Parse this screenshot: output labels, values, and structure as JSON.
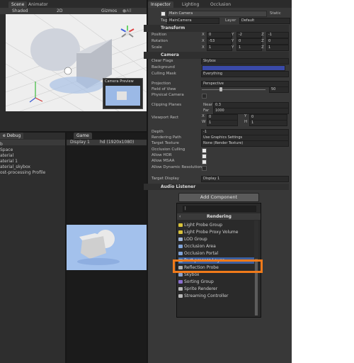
{
  "scene": {
    "tabs": [
      "Scene",
      "Animator"
    ],
    "shading": "Shaded",
    "mode_2d": "2D",
    "gizmos": "Gizmos",
    "search": "●All",
    "camera_preview_title": "Camera Preview"
  },
  "left_panel": {
    "tab": "e Debug",
    "items": [
      "b",
      "Space",
      "aterial",
      "aterial 1",
      "aterial_skybox",
      "ost-processing Profile"
    ]
  },
  "game": {
    "tab": "Game",
    "display": "Display 1",
    "resolution": "hd (1920x1080)"
  },
  "inspector": {
    "tabs": [
      "Inspector",
      "Lighting",
      "Occlusion"
    ],
    "object_name": "Main Camera",
    "static_label": "Static",
    "tag_label": "Tag",
    "tag_value": "MainCamera",
    "layer_label": "Layer",
    "layer_value": "Default",
    "transform": {
      "title": "Transform",
      "rows": [
        {
          "label": "Position",
          "x": "0",
          "y": "-2",
          "z": "-1"
        },
        {
          "label": "Rotation",
          "x": "-53",
          "y": "0",
          "z": "0"
        },
        {
          "label": "Scale",
          "x": "1",
          "y": "1",
          "z": "1"
        }
      ]
    },
    "camera": {
      "title": "Camera",
      "clear_flags": {
        "label": "Clear Flags",
        "value": "Skybox"
      },
      "background": {
        "label": "Background",
        "color": "#3a4aa8"
      },
      "culling_mask": {
        "label": "Culling Mask",
        "value": "Everything"
      },
      "projection": {
        "label": "Projection",
        "value": "Perspective"
      },
      "fov": {
        "label": "Field of View",
        "value": "50",
        "fraction": 0.28
      },
      "physical": "Physical Camera",
      "clipping": {
        "label": "Clipping Planes",
        "near_label": "Near",
        "near": "0.3",
        "far_label": "Far",
        "far": "1000"
      },
      "viewport": {
        "label": "Viewport Rect",
        "x": "0",
        "y": "0",
        "w": "1",
        "h": "1"
      },
      "depth": {
        "label": "Depth",
        "value": "-1"
      },
      "rendering_path": {
        "label": "Rendering Path",
        "value": "Use Graphics Settings"
      },
      "target_texture": {
        "label": "Target Texture",
        "value": "None (Render Texture)"
      },
      "occlusion_culling": "Occlusion Culling",
      "allow_hdr": "Allow HDR",
      "allow_msaa": "Allow MSAA",
      "allow_dyn": "Allow Dynamic Resolution",
      "target_display": {
        "label": "Target Display",
        "value": "Display 1"
      }
    },
    "audio_listener": "Audio Listener",
    "add_component": "Add Component"
  },
  "popup": {
    "search": "|",
    "category": "Rendering",
    "items": [
      {
        "label": "Light Probe Group",
        "icon": "light-probe-icon",
        "color": "#d8c23a"
      },
      {
        "label": "Light Probe Proxy Volume",
        "icon": "light-probe-proxy-icon",
        "color": "#d8c23a"
      },
      {
        "label": "LOD Group",
        "icon": "lod-group-icon",
        "color": "#9db4d8"
      },
      {
        "label": "Occlusion Area",
        "icon": "occlusion-area-icon",
        "color": "#7fa3d9"
      },
      {
        "label": "Occlusion Portal",
        "icon": "occlusion-portal-icon",
        "color": "#7fa3d9"
      },
      {
        "label": "Post-process Layer",
        "icon": "post-process-icon",
        "color": "#6fb0e8"
      },
      {
        "label": "Reflection Probe",
        "icon": "reflection-probe-icon",
        "color": "#b0b0b0"
      },
      {
        "label": "Skybox",
        "icon": "skybox-icon",
        "color": "#8aa0c8"
      },
      {
        "label": "Sorting Group",
        "icon": "sorting-group-icon",
        "color": "#8b6fd0"
      },
      {
        "label": "Sprite Renderer",
        "icon": "sprite-renderer-icon",
        "color": "#b8b8b8"
      },
      {
        "label": "Streaming Controller",
        "icon": "streaming-controller-icon",
        "color": "#b8b8b8"
      }
    ],
    "highlight_color": "#f07a1a"
  }
}
